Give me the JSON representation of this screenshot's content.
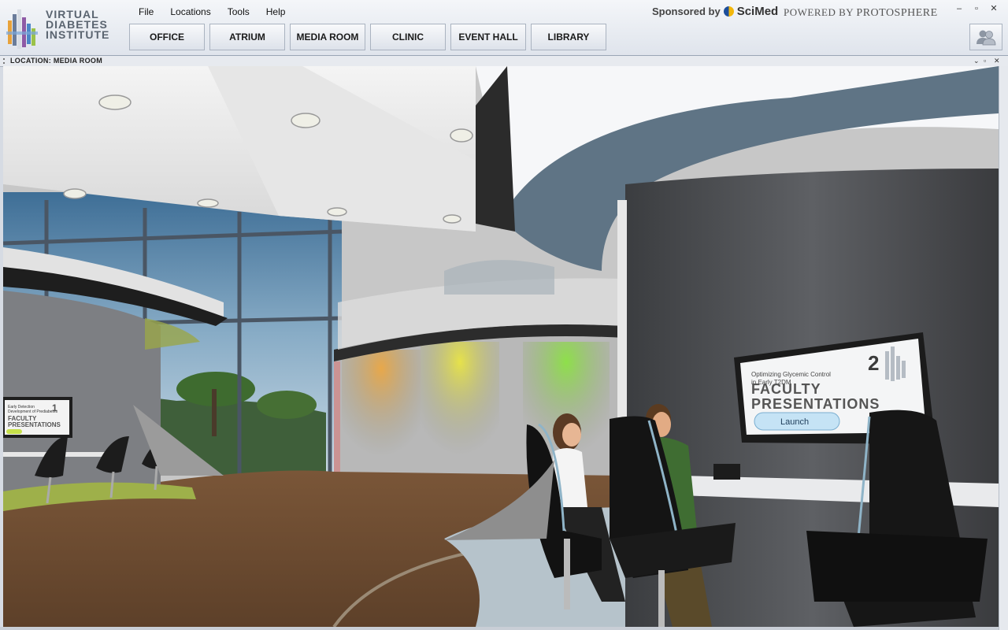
{
  "logo": {
    "line1": "VIRTUAL",
    "line2": "DIABETES",
    "line3": "INSTITUTE"
  },
  "menu": [
    "File",
    "Locations",
    "Tools",
    "Help"
  ],
  "sponsor": {
    "prefix": "Sponsored by",
    "brand": "SciMed"
  },
  "powered": {
    "prefix": "POWERED BY",
    "brand": "PROTOSPHERE"
  },
  "nav": [
    "OFFICE",
    "ATRIUM",
    "MEDIA ROOM",
    "CLINIC",
    "EVENT HALL",
    "LIBRARY"
  ],
  "location": {
    "label": "LOCATION: MEDIA ROOM"
  },
  "window_controls": {
    "minimize": "–",
    "restore": "▫",
    "close": "✕"
  },
  "scene": {
    "screen_right": {
      "subtitle_line1": "Optimizing Glycemic Control",
      "subtitle_line2": "in Early T2DM",
      "number": "2",
      "title_line1": "FACULTY",
      "title_line2": "PRESENTATIONS",
      "button": "Launch"
    },
    "screen_left": {
      "line1": "Early Detection",
      "line2": "Development of Prediabetes",
      "number": "1",
      "title_line1": "FACULTY",
      "title_line2": "PRESENTATIONS"
    }
  }
}
